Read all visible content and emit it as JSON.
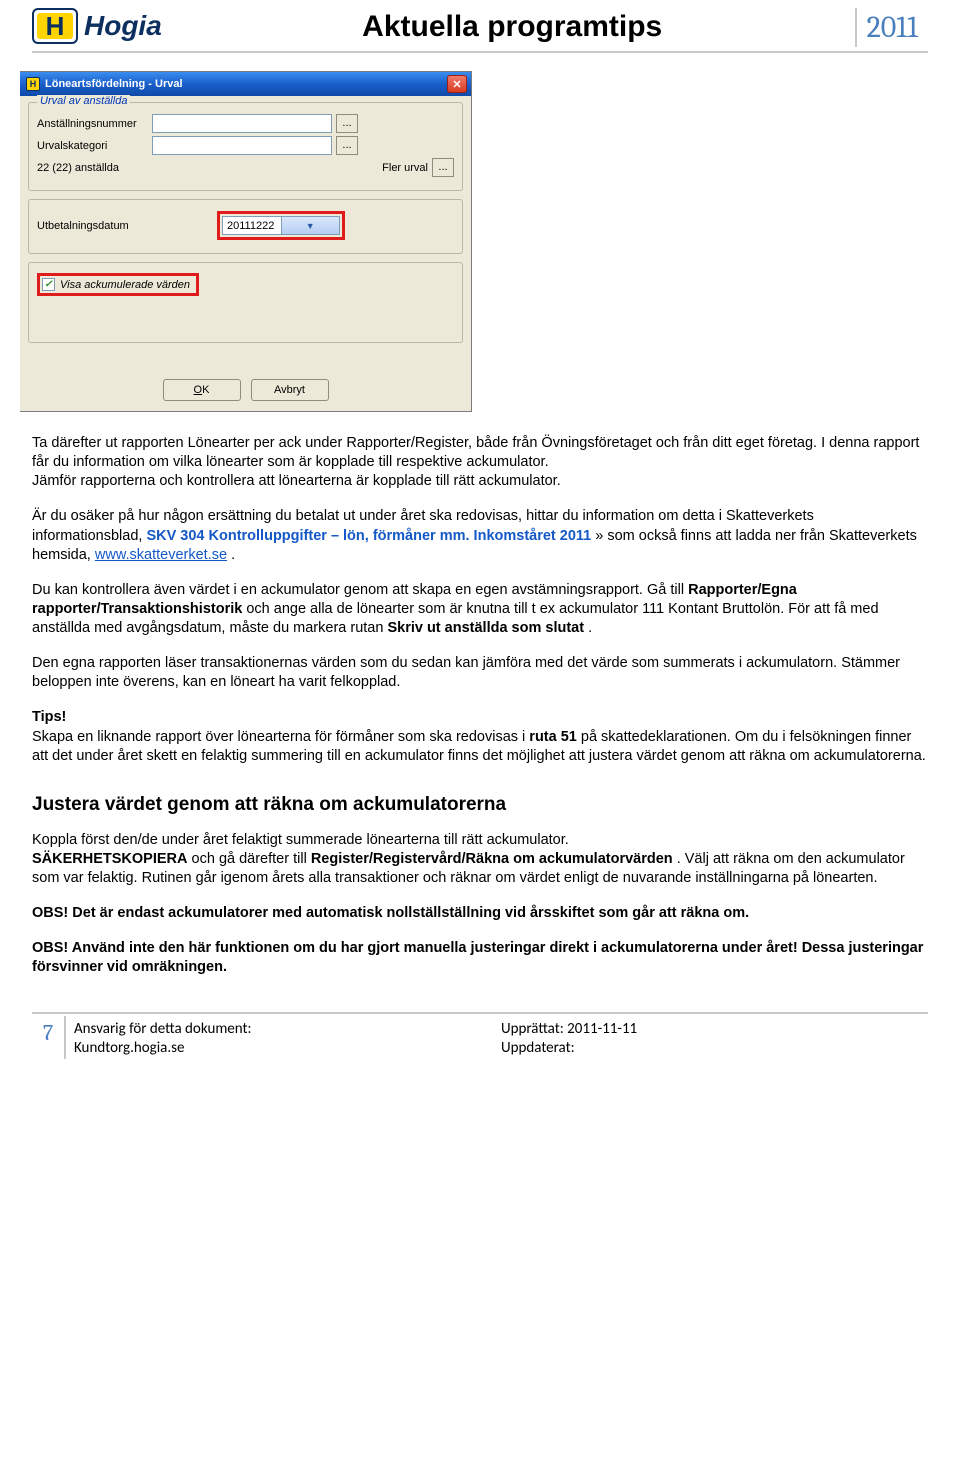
{
  "header": {
    "logo_letter": "H",
    "logo_text": "Hogia",
    "title": "Aktuella programtips",
    "year": "2011"
  },
  "dialog": {
    "title": "Löneartsfördelning - Urval",
    "group_title": "Urval av anställda",
    "row_anst_nr": "Anställningsnummer",
    "row_urvalskat": "Urvalskategori",
    "row_count": "22 (22) anställda",
    "row_flerurval": "Fler urval",
    "row_utbetdatum": "Utbetalningsdatum",
    "payout_date": "20111222",
    "chk_label": "Visa ackumulerade värden",
    "btn_ok": "OK",
    "btn_cancel": "Avbryt",
    "ellipsis": "..."
  },
  "body": {
    "p1a": "Ta därefter ut rapporten Lönearter per ack under Rapporter/Register, både från Övningsföretaget och från ditt eget företag. I denna rapport får du information om vilka lönearter som är kopplade till respektive ackumulator.",
    "p1b": "Jämför rapporterna och kontrollera att lönearterna är kopplade till rätt ackumulator.",
    "p2a": "Är du osäker på hur någon ersättning du betalat ut under året ska redovisas, hittar du information om detta i Skatteverkets informationsblad, ",
    "p2link1": "SKV 304 Kontrolluppgifter – lön, förmåner mm. Inkomståret 2011",
    "p2b": "» som också finns att ladda ner från Skatteverkets hemsida, ",
    "p2link2": "www.skatteverket.se",
    "p2c": ".",
    "p3a": "Du kan kontrollera även värdet i en ackumulator genom att skapa en egen avstämningsrapport. Gå till ",
    "p3b1": "Rapporter/Egna rapporter/Transaktionshistorik",
    "p3c": " och ange alla de lönearter som är knutna till t ex ackumulator 111 Kontant Bruttolön. För att få med anställda med avgångsdatum, måste du markera rutan ",
    "p3b2": "Skriv ut anställda som slutat",
    "p3d": ".",
    "p4": "Den egna rapporten läser transaktionernas värden som du sedan kan jämföra med det värde som summerats i ackumulatorn. Stämmer beloppen inte överens, kan en löneart ha varit felkopplad.",
    "tips_head": "Tips!",
    "tips_body": "Skapa en liknande rapport över lönearterna för förmåner som ska redovisas i ",
    "tips_b": "ruta 51",
    "tips_body2": " på skattedeklarationen. Om du i felsökningen finner att det under året skett en felaktig summering till en ackumulator finns det möjlighet att justera värdet genom att räkna om ackumulatorerna.",
    "h2": "Justera värdet genom att räkna om ackumulatorerna",
    "p6a": "Koppla först den/de under året felaktigt summerade lönearterna till rätt ackumulator. ",
    "p6b1": "SÄKERHETSKOPIERA",
    "p6b": " och gå därefter till ",
    "p6b2": "Register/Registervård/Räkna om ackumulatorvärden",
    "p6c": ". Välj att räkna om den ackumulator som var felaktig. Rutinen går igenom årets alla transaktioner och räknar om värdet enligt de nuvarande inställningarna på lönearten.",
    "obs1": "OBS! Det är endast ackumulatorer med automatisk nollställställning vid årsskiftet som går att räkna om.",
    "obs2": "OBS! Använd inte den här funktionen om du har gjort manuella justeringar direkt i ackumulatorerna under året! Dessa justeringar försvinner vid omräkningen."
  },
  "footer": {
    "page": "7",
    "col1_l1": "Ansvarig för detta dokument:",
    "col1_l2": "Kundtorg.hogia.se",
    "col2_l1": "Upprättat: 2011-11-11",
    "col2_l2": "Uppdaterat:"
  }
}
